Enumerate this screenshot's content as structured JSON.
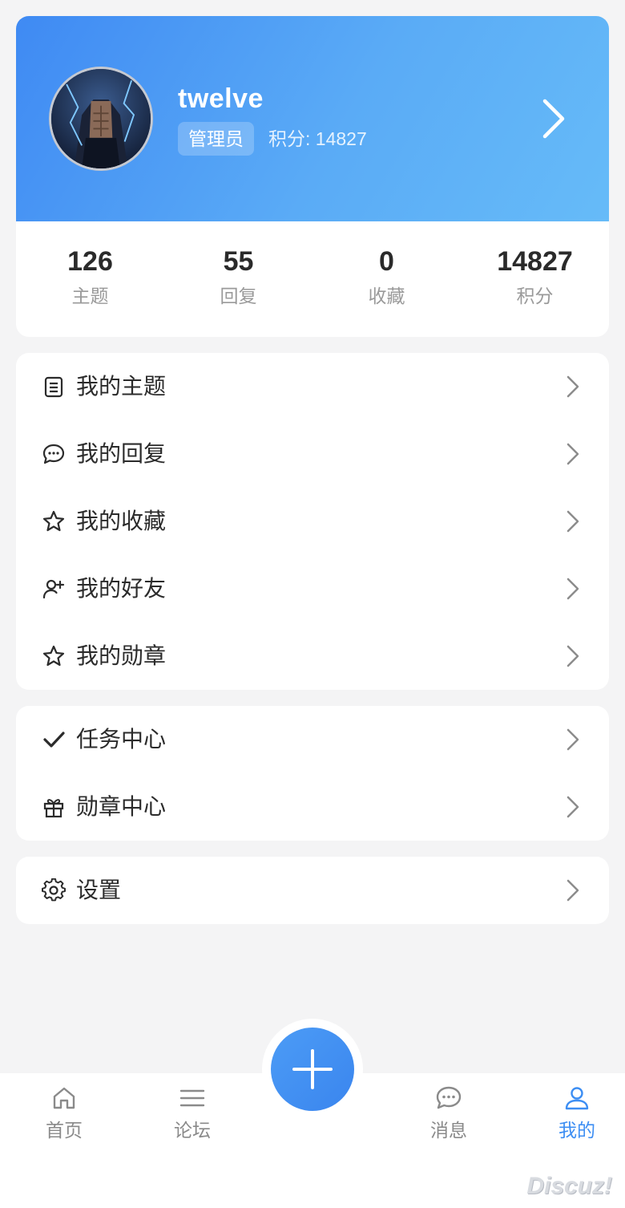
{
  "profile": {
    "username": "twelve",
    "role": "管理员",
    "points_text": "积分: 14827"
  },
  "stats": [
    {
      "value": "126",
      "label": "主题"
    },
    {
      "value": "55",
      "label": "回复"
    },
    {
      "value": "0",
      "label": "收藏"
    },
    {
      "value": "14827",
      "label": "积分"
    }
  ],
  "menu_group_1": [
    {
      "icon": "document-icon",
      "label": "我的主题"
    },
    {
      "icon": "chat-bubble-icon",
      "label": "我的回复"
    },
    {
      "icon": "star-icon",
      "label": "我的收藏"
    },
    {
      "icon": "add-friend-icon",
      "label": "我的好友"
    },
    {
      "icon": "star-icon",
      "label": "我的勋章"
    }
  ],
  "menu_group_2": [
    {
      "icon": "check-icon",
      "label": "任务中心"
    },
    {
      "icon": "gift-icon",
      "label": "勋章中心"
    }
  ],
  "menu_group_3": [
    {
      "icon": "gear-icon",
      "label": "设置"
    }
  ],
  "tabbar": {
    "items": [
      {
        "icon": "home-icon",
        "label": "首页",
        "active": false
      },
      {
        "icon": "menu-icon",
        "label": "论坛",
        "active": false
      },
      {
        "icon": "message-icon",
        "label": "消息",
        "active": false
      },
      {
        "icon": "user-icon",
        "label": "我的",
        "active": true
      }
    ],
    "fab_icon": "plus-icon"
  },
  "colors": {
    "accent": "#3d8ef3",
    "header_gradient_start": "#3f8af3",
    "header_gradient_end": "#66bbf8",
    "background": "#f4f4f5"
  },
  "watermark": "Discuz!"
}
